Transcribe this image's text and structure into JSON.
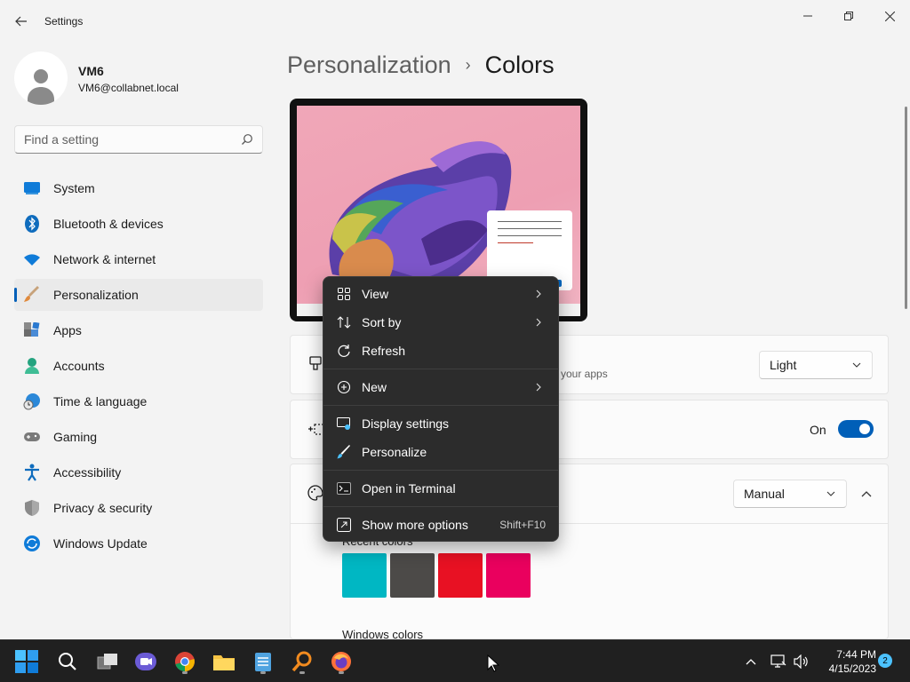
{
  "window": {
    "app_title": "Settings"
  },
  "user": {
    "name": "VM6",
    "email": "VM6@collabnet.local"
  },
  "search": {
    "placeholder": "Find a setting"
  },
  "sidebar": {
    "items": [
      {
        "label": "System",
        "icon": "monitor-icon"
      },
      {
        "label": "Bluetooth & devices",
        "icon": "bluetooth-icon"
      },
      {
        "label": "Network & internet",
        "icon": "wifi-icon"
      },
      {
        "label": "Personalization",
        "icon": "paintbrush-icon",
        "active": true
      },
      {
        "label": "Apps",
        "icon": "apps-icon"
      },
      {
        "label": "Accounts",
        "icon": "person-icon"
      },
      {
        "label": "Time & language",
        "icon": "globe-clock-icon"
      },
      {
        "label": "Gaming",
        "icon": "gamepad-icon"
      },
      {
        "label": "Accessibility",
        "icon": "accessibility-icon"
      },
      {
        "label": "Privacy & security",
        "icon": "shield-icon"
      },
      {
        "label": "Windows Update",
        "icon": "update-icon"
      }
    ]
  },
  "main": {
    "breadcrumb_parent": "Personalization",
    "breadcrumb_separator": "›",
    "breadcrumb_current": "Colors",
    "mode_card": {
      "description_fragment": "d your apps",
      "dropdown_value": "Light"
    },
    "transparency_card": {
      "toggle_label": "On",
      "toggle_on": true
    },
    "accent_card": {
      "dropdown_value": "Manual",
      "recent_colors_label": "Recent colors",
      "windows_colors_label": "Windows colors",
      "recent_colors": [
        "#00b7c3",
        "#4c4a48",
        "#e81123",
        "#ea005e"
      ]
    }
  },
  "context_menu": {
    "items": [
      {
        "label": "View",
        "icon": "grid-icon",
        "submenu": true
      },
      {
        "label": "Sort by",
        "icon": "sort-icon",
        "submenu": true
      },
      {
        "label": "Refresh",
        "icon": "refresh-icon"
      },
      {
        "label": "New",
        "icon": "plus-circle-icon",
        "submenu": true
      },
      {
        "label": "Display settings",
        "icon": "display-settings-icon"
      },
      {
        "label": "Personalize",
        "icon": "brush-icon"
      },
      {
        "label": "Open in Terminal",
        "icon": "terminal-icon"
      },
      {
        "label": "Show more options",
        "icon": "more-options-icon",
        "shortcut": "Shift+F10"
      }
    ]
  },
  "taskbar": {
    "time": "7:44 PM",
    "date": "4/15/2023",
    "notification_count": "2"
  },
  "colors": {
    "accent": "#005fb8",
    "menu_bg": "#2c2c2c",
    "taskbar_bg": "#202020"
  }
}
